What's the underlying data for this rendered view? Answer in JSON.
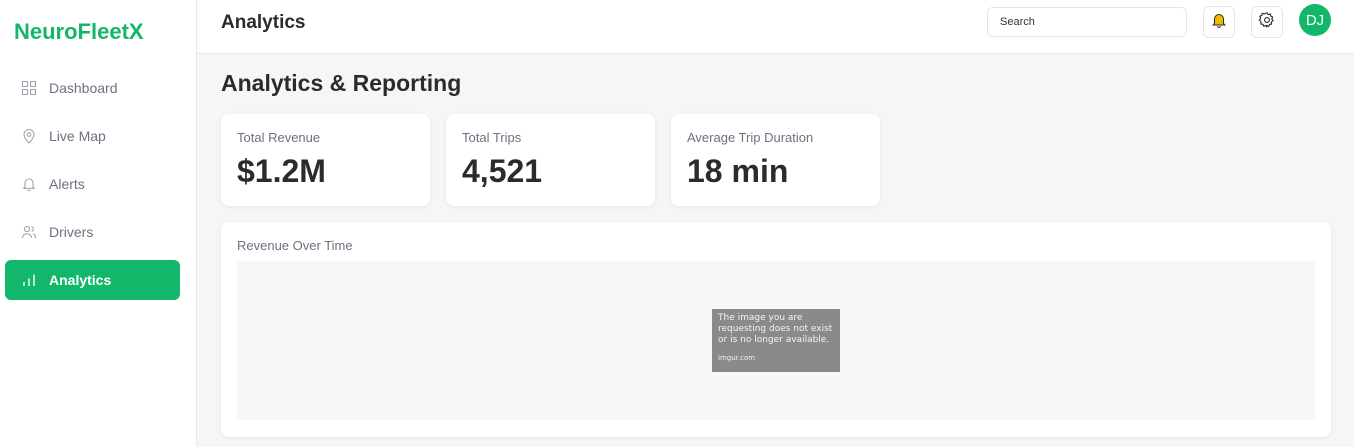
{
  "sidebar": {
    "brand": "NeuroFleetX",
    "items": [
      {
        "label": "Dashboard",
        "icon": "grid-icon"
      },
      {
        "label": "Live Map",
        "icon": "map-pin-icon"
      },
      {
        "label": "Alerts",
        "icon": "bell-icon"
      },
      {
        "label": "Drivers",
        "icon": "users-icon"
      },
      {
        "label": "Analytics",
        "icon": "bar-chart-icon"
      }
    ],
    "active": "Analytics"
  },
  "header": {
    "title": "Analytics",
    "search_placeholder": "Search",
    "avatar_initials": "DJ"
  },
  "main": {
    "page_title": "Analytics & Reporting",
    "stats": [
      {
        "label": "Total Revenue",
        "value": "$1.2M"
      },
      {
        "label": "Total Trips",
        "value": "4,521"
      },
      {
        "label": "Average Trip Duration",
        "value": "18 min"
      }
    ],
    "chart_panel": {
      "label": "Revenue Over Time",
      "placeholder_text": [
        "The image you are",
        "requesting does not exist",
        "or is no longer available."
      ],
      "placeholder_source": "imgur.com"
    }
  },
  "colors": {
    "accent": "#12b76a",
    "bell": "#f5b800"
  }
}
